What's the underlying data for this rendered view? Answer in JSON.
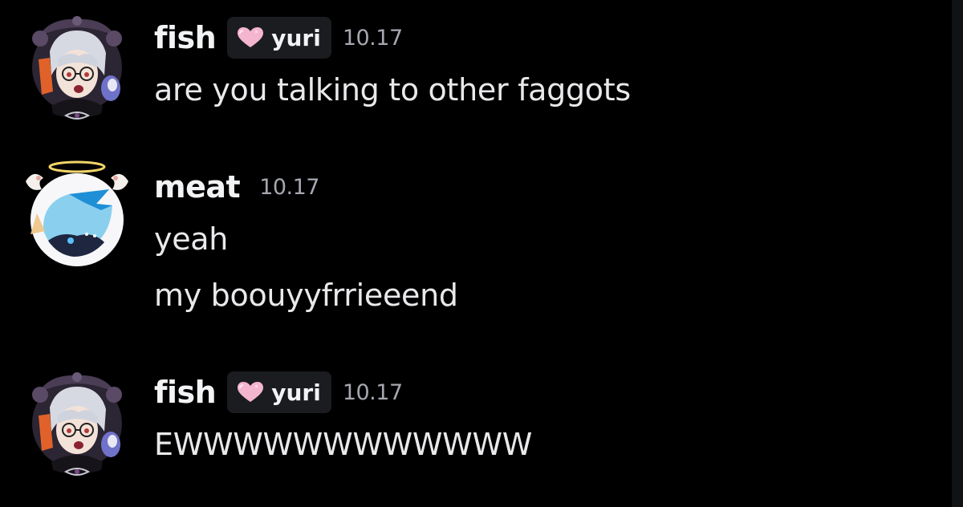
{
  "messages": [
    {
      "author": "fish",
      "tag": {
        "label": "yuri",
        "icon": "pink-heart-icon"
      },
      "timestamp": "10.17",
      "lines": [
        "are you talking to other faggots"
      ]
    },
    {
      "author": "meat",
      "timestamp": "10.17",
      "lines": [
        "yeah",
        "my boouyyfrrieeend"
      ]
    },
    {
      "author": "fish",
      "tag": {
        "label": "yuri",
        "icon": "pink-heart-icon"
      },
      "timestamp": "10.17",
      "lines": [
        "EWWWWWWWWWWWW"
      ]
    }
  ],
  "colors": {
    "background": "#000000",
    "username": "#f2f3f5",
    "message_text": "#e9e9ec",
    "timestamp": "#a6a8b0",
    "tag_background": "#1b1c20",
    "tag_heart": "#f4b6cf"
  }
}
